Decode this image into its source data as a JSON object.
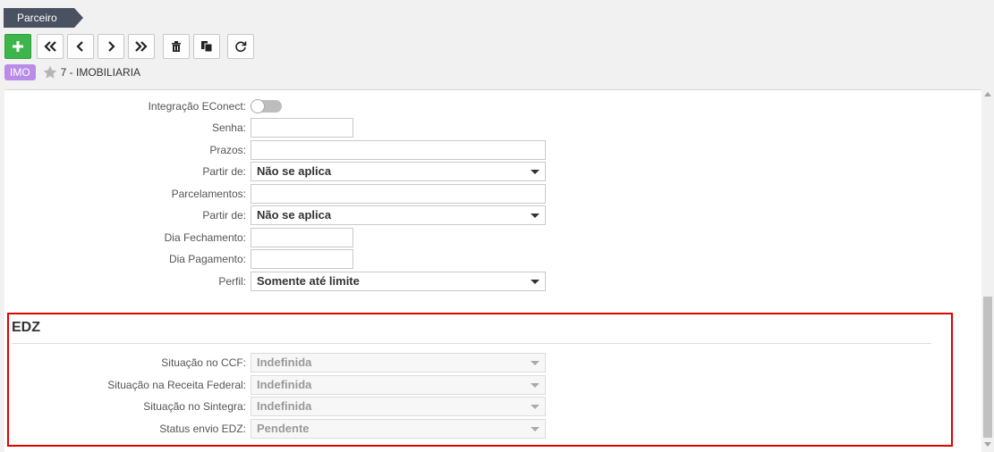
{
  "header": {
    "breadcrumb": "Parceiro",
    "record_badge": "IMO",
    "record_title": "7 - IMOBILIARIA"
  },
  "toolbar": {
    "buttons": [
      "add",
      "first",
      "previous",
      "next",
      "last",
      "delete",
      "copy",
      "refresh"
    ]
  },
  "form": {
    "integracao_label": "Integração EConect:",
    "integracao_on": false,
    "senha_label": "Senha:",
    "senha_value": "",
    "prazos_label": "Prazos:",
    "prazos_value": "",
    "partir_de_1_label": "Partir de:",
    "partir_de_1_value": "Não se aplica",
    "parcelamentos_label": "Parcelamentos:",
    "parcelamentos_value": "",
    "partir_de_2_label": "Partir de:",
    "partir_de_2_value": "Não se aplica",
    "dia_fechamento_label": "Dia Fechamento:",
    "dia_fechamento_value": "",
    "dia_pagamento_label": "Dia Pagamento:",
    "dia_pagamento_value": "",
    "perfil_label": "Perfil:",
    "perfil_value": "Somente até limite"
  },
  "edz": {
    "title": "EDZ",
    "ccf_label": "Situação no CCF:",
    "ccf_value": "Indefinida",
    "receita_label": "Situação na Receita Federal:",
    "receita_value": "Indefinida",
    "sintegra_label": "Situação no Sintegra:",
    "sintegra_value": "Indefinida",
    "status_label": "Status envio EDZ:",
    "status_value": "Pendente"
  },
  "colors": {
    "add_button": "#3cb54a",
    "badge": "#b98ce8",
    "breadcrumb": "#4a5262",
    "highlight_border": "#e00000"
  }
}
